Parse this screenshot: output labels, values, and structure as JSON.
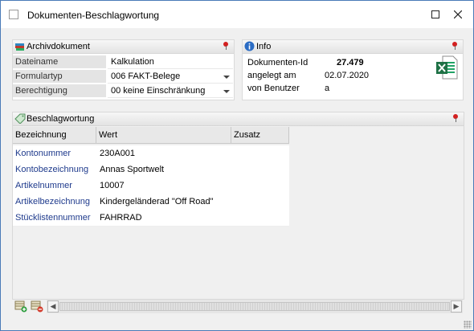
{
  "window": {
    "title": "Dokumenten-Beschlagwortung"
  },
  "archiv": {
    "title": "Archivdokument",
    "rows": [
      {
        "label": "Dateiname",
        "value": "Kalkulation"
      },
      {
        "label": "Formulartyp",
        "value": "006 FAKT-Belege"
      },
      {
        "label": "Berechtigung",
        "value": "00 keine Einschränkung"
      }
    ]
  },
  "info": {
    "title": "Info",
    "rows": [
      {
        "label": "Dokumenten-Id",
        "value": "27.479"
      },
      {
        "label": "angelegt am",
        "value": "02.07.2020"
      },
      {
        "label": "von Benutzer",
        "value": "a"
      }
    ],
    "file_icon": "excel-icon"
  },
  "beschlag": {
    "title": "Beschlagwortung",
    "columns": [
      "Bezeichnung",
      "Wert",
      "Zusatz"
    ],
    "rows": [
      {
        "bezeichnung": "Kontonummer",
        "wert": "230A001"
      },
      {
        "bezeichnung": "Kontobezeichnung",
        "wert": "Annas Sportwelt"
      },
      {
        "bezeichnung": "Artikelnummer",
        "wert": "10007"
      },
      {
        "bezeichnung": "Artikelbezeichnung",
        "wert": "Kindergeländerad \"Off Road\""
      },
      {
        "bezeichnung": "Stücklistennummer",
        "wert": "FAHRRAD"
      }
    ]
  },
  "colors": {
    "accent_border": "#4a7ab8",
    "label_text": "#1e3a8c",
    "pin": "#d32020",
    "excel": "#1e7145"
  }
}
